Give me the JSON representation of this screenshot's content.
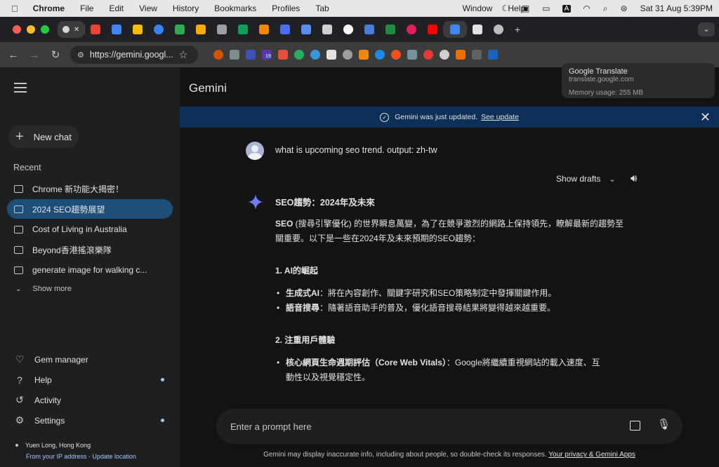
{
  "menubar": {
    "apple": "",
    "app": "Chrome",
    "items": [
      "File",
      "Edit",
      "View",
      "History",
      "Bookmarks",
      "Profiles",
      "Tab"
    ],
    "window": "Window",
    "help": "Help",
    "input_badge": "A",
    "datetime": "Sat 31 Aug  5:39PM"
  },
  "tabstrip": {
    "new_tab": "+",
    "tab_search": "⌄",
    "active_close": "✕"
  },
  "toolbar": {
    "back": "←",
    "forward": "→",
    "reload": "↻",
    "url": "https://gemini.googl...",
    "star": "☆",
    "ext_badge": "19"
  },
  "popover": {
    "title": "Google Translate",
    "domain": "translate.google.com",
    "memory": "Memory usage: 255 MB"
  },
  "sidebar": {
    "new_chat": "New chat",
    "recent_label": "Recent",
    "chats": [
      {
        "label": "Chrome 新功能大揭密！"
      },
      {
        "label": "2024 SEO趨勢展望"
      },
      {
        "label": "Cost of Living in Australia"
      },
      {
        "label": "Beyond香港搖滾樂隊"
      },
      {
        "label": "generate image for walking c..."
      }
    ],
    "show_more": "Show more",
    "bottom": [
      {
        "label": "Gem manager",
        "icon": "gem-icon"
      },
      {
        "label": "Help",
        "icon": "help-icon"
      },
      {
        "label": "Activity",
        "icon": "history-icon"
      },
      {
        "label": "Settings",
        "icon": "gear-icon"
      }
    ],
    "location": "Yuen Long, Hong Kong",
    "location_source": "From your IP address",
    "update_location": "Update location"
  },
  "header": {
    "title": "Gemini"
  },
  "banner": {
    "text": "Gemini was just updated.",
    "link": "See update"
  },
  "conversation": {
    "user_message": "what is upcoming seo trend. output: zh-tw",
    "show_drafts": "Show drafts",
    "response": {
      "heading": "SEO趨勢：2024年及未來",
      "intro_bold": "SEO",
      "intro": " (搜尋引擎優化) 的世界瞬息萬變，為了在競爭激烈的網路上保持領先，瞭解最新的趨勢至關重要。以下是一些在2024年及未來預期的SEO趨勢：",
      "section1": "1. AI的崛起",
      "s1_items": [
        {
          "bold": "生成式AI",
          "text": "：將在內容創作、關鍵字研究和SEO策略制定中發揮關鍵作用。"
        },
        {
          "bold": "語音搜尋",
          "text": "：隨著語音助手的普及，優化語音搜尋結果將變得越來越重要。"
        }
      ],
      "section2": "2. 注重用戶體驗",
      "s2_items": [
        {
          "bold": "核心網頁生命週期評估（Core Web Vitals）",
          "text": "：Google將繼續重視網站的載入速度、互動性以及視覺穩定性。"
        }
      ]
    }
  },
  "prompt": {
    "placeholder": "Enter a prompt here"
  },
  "footer": {
    "disclaimer": "Gemini may display inaccurate info, including about people, so double-check its responses.",
    "privacy_link": "Your privacy & Gemini Apps"
  },
  "colors": {
    "accent": "#a8c7fa",
    "active_chat": "#1e4f7a",
    "banner": "#0e2f57"
  }
}
